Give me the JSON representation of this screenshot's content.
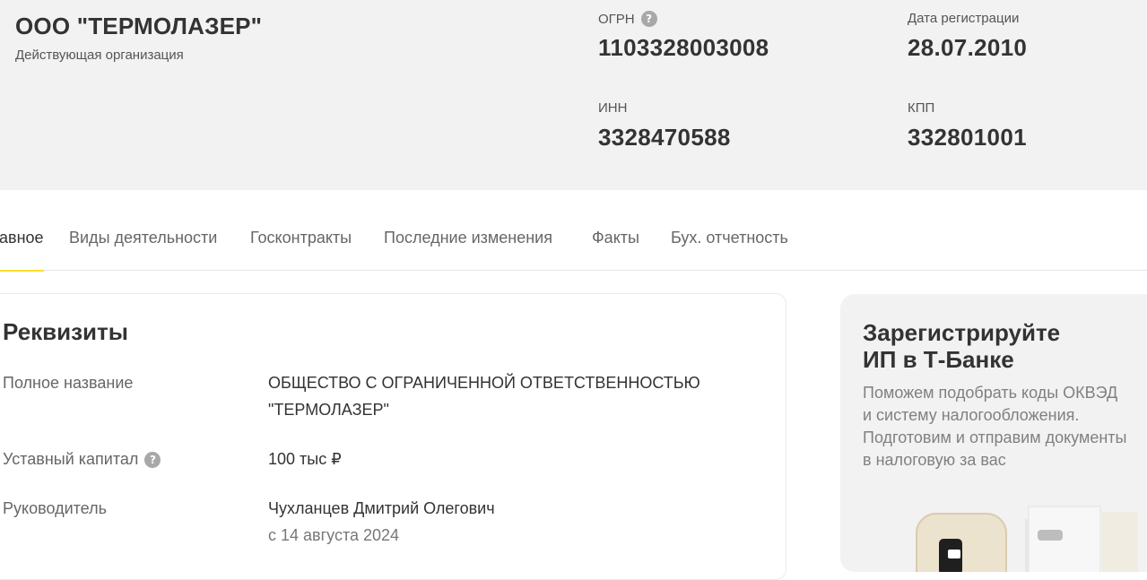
{
  "company": {
    "name": "ООО \"ТЕРМОЛАЗЕР\"",
    "status": "Действующая организация"
  },
  "header_fields": {
    "ogrn": {
      "label": "ОГРН",
      "value": "1103328003008"
    },
    "reg_date": {
      "label": "Дата регистрации",
      "value": "28.07.2010"
    },
    "inn": {
      "label": "ИНН",
      "value": "3328470588"
    },
    "kpp": {
      "label": "КПП",
      "value": "332801001"
    },
    "help_icon": "?"
  },
  "tabs": [
    {
      "label": "авное",
      "active": true
    },
    {
      "label": "Виды деятельности",
      "active": false
    },
    {
      "label": "Госконтракты",
      "active": false
    },
    {
      "label": "Последние изменения",
      "active": false
    },
    {
      "label": "Факты",
      "active": false
    },
    {
      "label": "Бух. отчетность",
      "active": false
    }
  ],
  "requisites": {
    "title": "Реквизиты",
    "full_name": {
      "label": "Полное название",
      "value_line1": "ОБЩЕСТВО С ОГРАНИЧЕННОЙ ОТВЕТСТВЕННОСТЬЮ",
      "value_line2": "\"ТЕРМОЛАЗЕР\""
    },
    "capital": {
      "label": "Уставный капитал",
      "value": "100 тыс ₽"
    },
    "director": {
      "label": "Руководитель",
      "value": "Чухланцев Дмитрий Олегович",
      "since": "с 14 августа 2024"
    }
  },
  "promo": {
    "title_line1": "Зарегистрируйте",
    "title_line2": "ИП в Т-Банке",
    "text_lines": [
      "Поможем подобрать коды ОКВЭД",
      "и систему налогообложения.",
      "Подготовим и отправим документы",
      "в налоговую за вас"
    ]
  },
  "colors": {
    "header_bg": "#f2f2f2",
    "accent": "#ffdd2d",
    "text_primary": "#333333",
    "text_secondary": "#666666"
  }
}
